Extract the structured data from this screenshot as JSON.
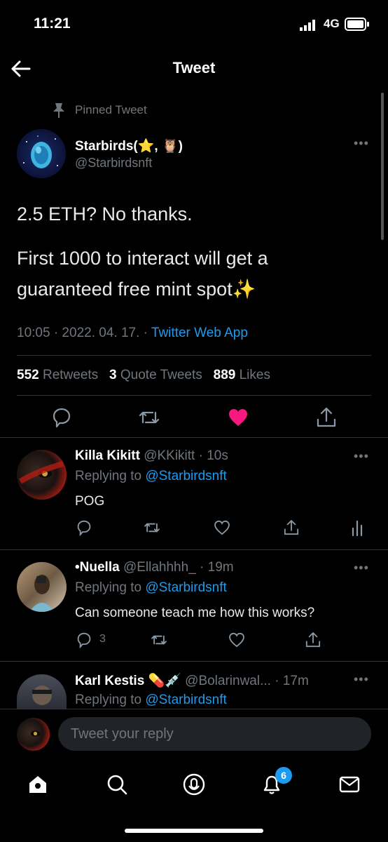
{
  "status": {
    "time": "11:21",
    "network": "4G"
  },
  "header": {
    "title": "Tweet"
  },
  "tweet": {
    "pinned_label": "Pinned Tweet",
    "author_name": "Starbirds(⭐, 🦉)",
    "author_handle": "@Starbirdsnft",
    "text_line1": "2.5 ETH? No thanks.",
    "text_line2": "First 1000 to interact will get a guaranteed free mint spot✨",
    "time": "10:05 · 2022. 04. 17. · ",
    "source": "Twitter Web App",
    "retweets_count": "552",
    "retweets_label": "Retweets",
    "quotes_count": "3",
    "quotes_label": "Quote Tweets",
    "likes_count": "889",
    "likes_label": "Likes",
    "liked": true
  },
  "replies": [
    {
      "name": "Killa Kikitt",
      "handle_time": "@KKikitt · 10s",
      "replying_prefix": "Replying to ",
      "replying_to": "@Starbirdsnft",
      "text": "POG"
    },
    {
      "name": "•Nuella",
      "handle_time": "@Ellahhhh_ · 19m",
      "replying_prefix": "Replying to ",
      "replying_to": "@Starbirdsnft",
      "text": "Can someone teach me how this works?",
      "reply_count": "3"
    },
    {
      "name": "Karl Kestis 💊💉",
      "handle_time": "@Bolarinwal... · 17m",
      "replying_prefix": "Replying to ",
      "replying_to": "@Starbirdsnft"
    }
  ],
  "composer": {
    "placeholder": "Tweet your reply"
  },
  "nav": {
    "notifications_badge": "6"
  },
  "colors": {
    "accent": "#1d9bf0",
    "like": "#f91880",
    "background": "#000000"
  }
}
